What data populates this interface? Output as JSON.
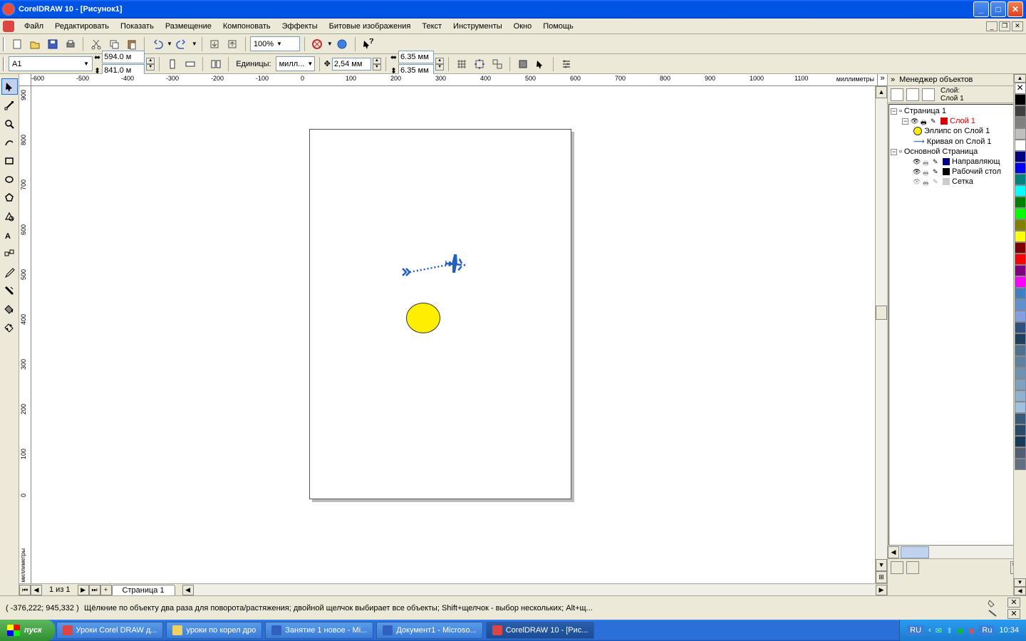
{
  "window": {
    "title": "CorelDRAW 10 - [Рисунок1]"
  },
  "menu": [
    "Файл",
    "Редактировать",
    "Показать",
    "Размещение",
    "Компоновать",
    "Эффекты",
    "Битовые изображения",
    "Текст",
    "Инструменты",
    "Окно",
    "Помощь"
  ],
  "std_toolbar": {
    "zoom": "100%"
  },
  "prop_toolbar": {
    "paper": "A1",
    "width": "594.0 м",
    "height": "841.0 м",
    "units_label": "Единицы:",
    "units": "милл...",
    "nudge": "2,54 мм",
    "dup_x": "6.35 мм",
    "dup_y": "6.35 мм"
  },
  "ruler": {
    "h_labels": [
      "-600",
      "-500",
      "-400",
      "-300",
      "-200",
      "-100",
      "0",
      "100",
      "200",
      "300",
      "400",
      "500",
      "600",
      "700",
      "800",
      "900",
      "1000",
      "1100"
    ],
    "h_unit": "миллиметры",
    "v_labels": [
      "900",
      "800",
      "700",
      "600",
      "500",
      "400",
      "300",
      "200",
      "100",
      "0"
    ],
    "v_unit": "миллиметры"
  },
  "pagebar": {
    "info": "1 из 1",
    "tab": "Страница 1"
  },
  "objmgr": {
    "title": "Менеджер объектов",
    "layer_label": "Слой:",
    "current_layer": "Слой 1",
    "page": "Страница 1",
    "layer1": "Слой 1",
    "obj1": "Эллипс on Слой 1",
    "obj2": "Кривая on Слой 1",
    "master": "Основной Страница",
    "guides": "Направляющ",
    "desktop": "Рабочий стол",
    "grid": "Сетка"
  },
  "status": {
    "coords": "( -376,222; 945,332 )",
    "hint": "Щёлкние по объекту два раза для поворота/растяжения; двойной щелчок выбирает все объекты; Shift+щелчок - выбор нескольких; Alt+щ..."
  },
  "taskbar": {
    "start": "пуск",
    "items": [
      "Уроки Corel DRAW д...",
      "уроки по корел дро",
      "Занятие 1 новое - Mi...",
      "Документ1 - Microso...",
      "CorelDRAW 10 - [Рис..."
    ],
    "lang": "RU",
    "lang2": "Ru",
    "time": "10:34"
  },
  "palette_colors": [
    "none",
    "#000000",
    "#404040",
    "#808080",
    "#c0c0c0",
    "#ffffff",
    "#000080",
    "#0000ff",
    "#008080",
    "#00ffff",
    "#008000",
    "#00ff00",
    "#808000",
    "#ffff00",
    "#800000",
    "#ff0000",
    "#800080",
    "#ff00ff",
    "#4080c0",
    "#6090d0",
    "#80a0e0",
    "#305080",
    "#204060",
    "#507090",
    "#6080a0",
    "#7090b0",
    "#80a0c0",
    "#90b0d0",
    "#a0c0e0",
    "#3a5a7a",
    "#2a4a6a",
    "#1a3a5a",
    "#506070",
    "#607080"
  ]
}
